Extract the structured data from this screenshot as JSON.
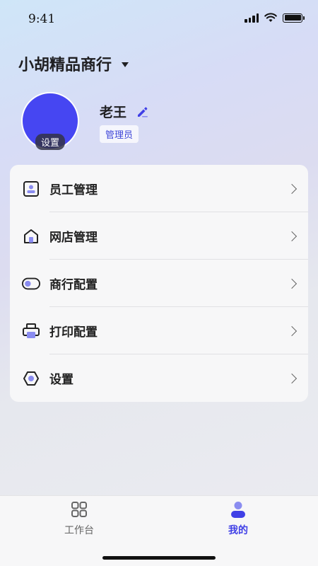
{
  "status_bar": {
    "time": "9:41"
  },
  "header": {
    "shop_name": "小胡精品商行"
  },
  "profile": {
    "avatar_badge": "设置",
    "name": "老王",
    "role": "管理员",
    "avatar_color": "#4646f2"
  },
  "menu": {
    "items": [
      {
        "label": "员工管理",
        "icon": "employee-card-icon"
      },
      {
        "label": "网店管理",
        "icon": "store-icon"
      },
      {
        "label": "商行配置",
        "icon": "toggle-icon"
      },
      {
        "label": "打印配置",
        "icon": "printer-icon"
      },
      {
        "label": "设置",
        "icon": "hexagon-settings-icon"
      }
    ]
  },
  "tabbar": {
    "tabs": [
      {
        "label": "工作台",
        "icon": "grid-icon",
        "active": false
      },
      {
        "label": "我的",
        "icon": "user-icon",
        "active": true
      }
    ]
  },
  "colors": {
    "accent": "#4040e6",
    "accent_light": "#8a8cf0",
    "text": "#1f1f22"
  }
}
